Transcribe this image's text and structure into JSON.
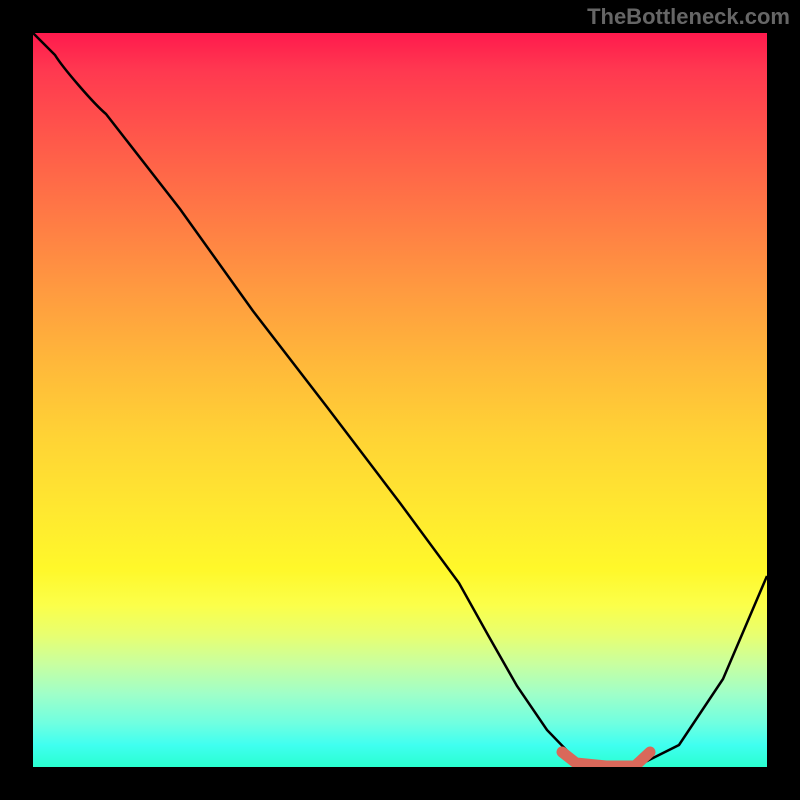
{
  "watermark": "TheBottleneck.com",
  "chart_data": {
    "type": "line",
    "title": "",
    "xlabel": "",
    "ylabel": "",
    "xlim": [
      0,
      100
    ],
    "ylim": [
      0,
      100
    ],
    "series": [
      {
        "name": "bottleneck-curve",
        "x": [
          0,
          3,
          10,
          20,
          30,
          40,
          50,
          58,
          62,
          66,
          70,
          74,
          78,
          82,
          88,
          94,
          100
        ],
        "y": [
          100,
          97,
          89,
          76,
          62,
          49,
          36,
          25,
          18,
          11,
          5,
          1,
          0,
          0,
          3,
          12,
          26
        ],
        "color": "#000000"
      },
      {
        "name": "highlight-segment",
        "x": [
          72,
          74,
          78,
          82,
          84
        ],
        "y": [
          2,
          0.5,
          0,
          0,
          2
        ],
        "color": "#d9685a",
        "stroke_width": 10
      }
    ],
    "background": {
      "type": "vertical-gradient",
      "stops": [
        {
          "pos": 0,
          "color": "#ff1a4d"
        },
        {
          "pos": 50,
          "color": "#ffcc33"
        },
        {
          "pos": 80,
          "color": "#fff82a"
        },
        {
          "pos": 100,
          "color": "#2affd0"
        }
      ]
    }
  }
}
